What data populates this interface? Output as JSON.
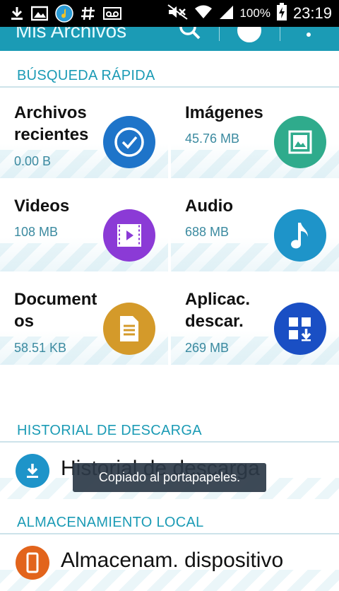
{
  "status_bar": {
    "battery": "100%",
    "time": "23:19"
  },
  "app_bar": {
    "title": "Mis Archivos"
  },
  "quick_search": {
    "header": "BÚSQUEDA RÁPIDA",
    "tiles": [
      {
        "label": "Archivos recientes",
        "size": "0.00 B",
        "icon": "check-icon",
        "color": "#1e74c9"
      },
      {
        "label": "Imágenes",
        "size": "45.76 MB",
        "icon": "image-icon",
        "color": "#2fab8c"
      },
      {
        "label": "Videos",
        "size": "108 MB",
        "icon": "video-icon",
        "color": "#8b3ad6"
      },
      {
        "label": "Audio",
        "size": "688 MB",
        "icon": "music-note-icon",
        "color": "#1e94c9"
      },
      {
        "label": "Document os",
        "size": "58.51 KB",
        "icon": "document-icon",
        "color": "#d49a2a"
      },
      {
        "label": "Aplicac. descar.",
        "size": "269 MB",
        "icon": "download-apps-icon",
        "color": "#1a4fc4"
      }
    ]
  },
  "download_history": {
    "header": "HISTORIAL DE DESCARGA",
    "item_label": "Historial de descarga",
    "icon_color": "#1e94c9"
  },
  "local_storage": {
    "header": "ALMACENAMIENTO LOCAL",
    "item_label": "Almacenam. dispositivo",
    "icon_color": "#e2641c"
  },
  "toast": {
    "text": "Copiado al portapapeles."
  }
}
